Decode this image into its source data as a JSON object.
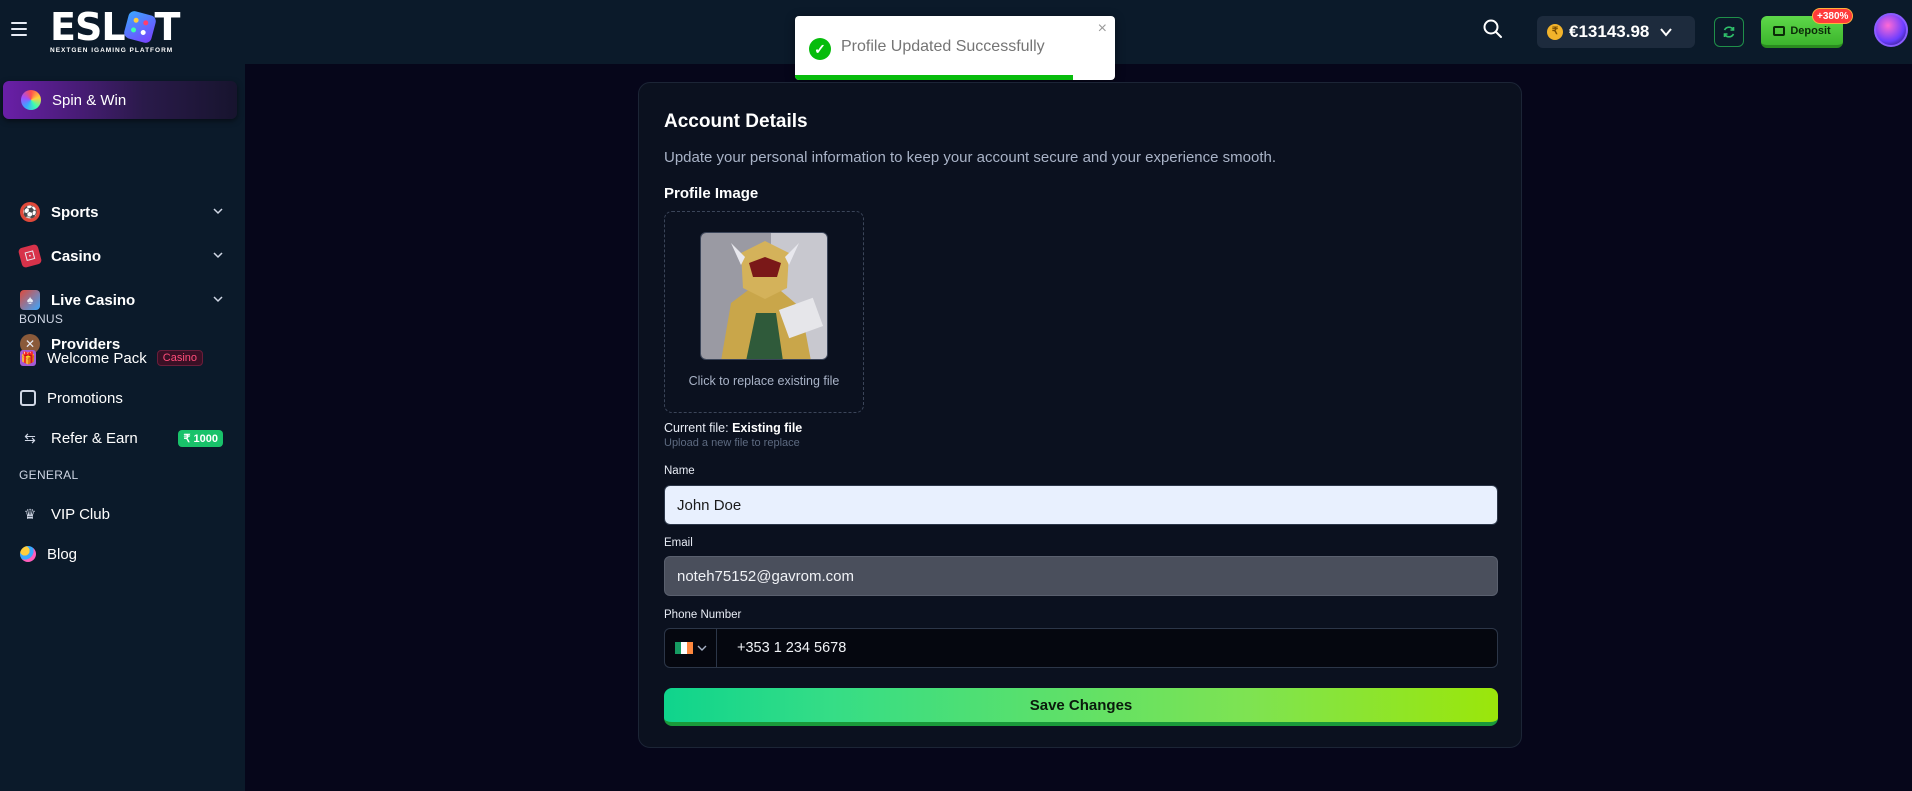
{
  "brand": {
    "name_left": "ESL",
    "name_right": "T",
    "tagline": "NEXTGEN IGAMING PLATFORM"
  },
  "toast": {
    "message": "Profile Updated Successfully",
    "close_glyph": "×",
    "progress_fraction": 0.87,
    "color": "#07bc0c"
  },
  "header": {
    "currency_symbol": "₹",
    "balance": "€13143.98",
    "deposit_label": "Deposit",
    "deposit_badge": "+380%"
  },
  "sidebar": {
    "spin": "Spin & Win",
    "items": [
      {
        "label": "Sports",
        "icon": "sports-icon"
      },
      {
        "label": "Casino",
        "icon": "casino-icon"
      },
      {
        "label": "Live Casino",
        "icon": "live-casino-icon"
      },
      {
        "label": "Providers",
        "icon": "providers-icon"
      }
    ],
    "bonus_header": "BONUS",
    "bonus_items": [
      {
        "label": "Welcome Pack",
        "tag": "Casino"
      },
      {
        "label": "Promotions"
      },
      {
        "label": "Refer & Earn",
        "tag": "₹ 1000"
      }
    ],
    "general_header": "GENERAL",
    "general_items": [
      {
        "label": "VIP Club"
      },
      {
        "label": "Blog"
      }
    ]
  },
  "account": {
    "title": "Account Details",
    "subtitle": "Update your personal information to keep your account secure and your experience smooth.",
    "profile_image_label": "Profile Image",
    "dropzone_text": "Click to replace existing file",
    "current_file_prefix": "Current file:",
    "current_file_name": "Existing file",
    "upload_hint": "Upload a new file to replace",
    "name_label": "Name",
    "name_value": "John Doe",
    "email_label": "Email",
    "email_value": "noteh75152@gavrom.com",
    "phone_label": "Phone Number",
    "phone_value": "+353 1 234 5678",
    "save_label": "Save Changes"
  },
  "colors": {
    "accent_green": "#35dd86",
    "sidebar_bg": "#0b1a2a",
    "page_bg": "#06061a"
  }
}
